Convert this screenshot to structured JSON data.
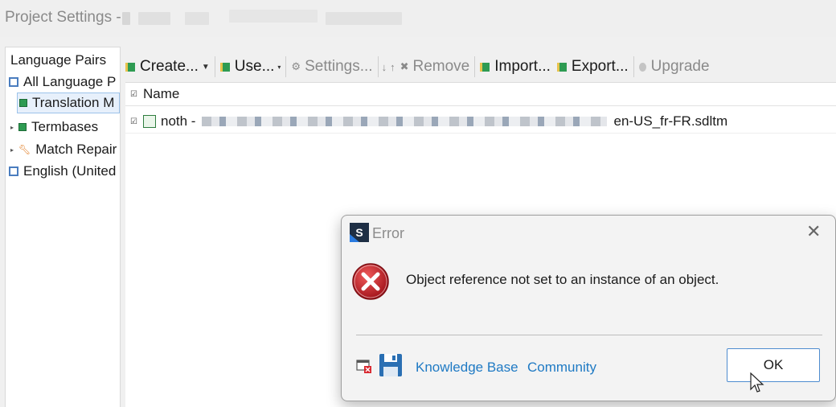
{
  "window": {
    "title": "Project Settings -"
  },
  "tree": {
    "items": [
      {
        "label": "Language Pairs"
      },
      {
        "label": "All Language P"
      },
      {
        "label": "Translation M"
      },
      {
        "label": "Termbases"
      },
      {
        "label": "Match Repair"
      },
      {
        "label": "English (United"
      }
    ]
  },
  "toolbar": {
    "create": "Create...",
    "use": "Use...",
    "settings": "Settings...",
    "remove": "Remove",
    "import": "Import...",
    "export": "Export...",
    "upgrade": "Upgrade"
  },
  "grid": {
    "header": "Name",
    "rows": [
      {
        "prefix": "noth -",
        "suffix": "en-US_fr-FR.sdltm"
      }
    ]
  },
  "dialog": {
    "logo_letter": "S",
    "title": "Error",
    "message": "Object reference not set to an instance of an object.",
    "link_kb": "Knowledge Base",
    "link_community": "Community",
    "ok": "OK"
  },
  "colors": {
    "accent": "#1f7ac4",
    "error_red": "#c8202a",
    "selection": "#e7f0fb"
  }
}
